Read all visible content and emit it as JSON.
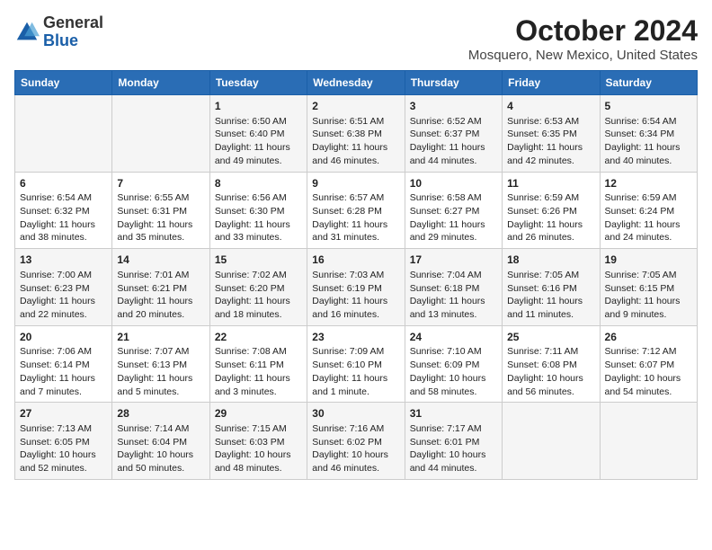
{
  "logo": {
    "general": "General",
    "blue": "Blue"
  },
  "title": "October 2024",
  "subtitle": "Mosquero, New Mexico, United States",
  "days_of_week": [
    "Sunday",
    "Monday",
    "Tuesday",
    "Wednesday",
    "Thursday",
    "Friday",
    "Saturday"
  ],
  "weeks": [
    [
      {
        "day": "",
        "info": ""
      },
      {
        "day": "",
        "info": ""
      },
      {
        "day": "1",
        "info": "Sunrise: 6:50 AM\nSunset: 6:40 PM\nDaylight: 11 hours and 49 minutes."
      },
      {
        "day": "2",
        "info": "Sunrise: 6:51 AM\nSunset: 6:38 PM\nDaylight: 11 hours and 46 minutes."
      },
      {
        "day": "3",
        "info": "Sunrise: 6:52 AM\nSunset: 6:37 PM\nDaylight: 11 hours and 44 minutes."
      },
      {
        "day": "4",
        "info": "Sunrise: 6:53 AM\nSunset: 6:35 PM\nDaylight: 11 hours and 42 minutes."
      },
      {
        "day": "5",
        "info": "Sunrise: 6:54 AM\nSunset: 6:34 PM\nDaylight: 11 hours and 40 minutes."
      }
    ],
    [
      {
        "day": "6",
        "info": "Sunrise: 6:54 AM\nSunset: 6:32 PM\nDaylight: 11 hours and 38 minutes."
      },
      {
        "day": "7",
        "info": "Sunrise: 6:55 AM\nSunset: 6:31 PM\nDaylight: 11 hours and 35 minutes."
      },
      {
        "day": "8",
        "info": "Sunrise: 6:56 AM\nSunset: 6:30 PM\nDaylight: 11 hours and 33 minutes."
      },
      {
        "day": "9",
        "info": "Sunrise: 6:57 AM\nSunset: 6:28 PM\nDaylight: 11 hours and 31 minutes."
      },
      {
        "day": "10",
        "info": "Sunrise: 6:58 AM\nSunset: 6:27 PM\nDaylight: 11 hours and 29 minutes."
      },
      {
        "day": "11",
        "info": "Sunrise: 6:59 AM\nSunset: 6:26 PM\nDaylight: 11 hours and 26 minutes."
      },
      {
        "day": "12",
        "info": "Sunrise: 6:59 AM\nSunset: 6:24 PM\nDaylight: 11 hours and 24 minutes."
      }
    ],
    [
      {
        "day": "13",
        "info": "Sunrise: 7:00 AM\nSunset: 6:23 PM\nDaylight: 11 hours and 22 minutes."
      },
      {
        "day": "14",
        "info": "Sunrise: 7:01 AM\nSunset: 6:21 PM\nDaylight: 11 hours and 20 minutes."
      },
      {
        "day": "15",
        "info": "Sunrise: 7:02 AM\nSunset: 6:20 PM\nDaylight: 11 hours and 18 minutes."
      },
      {
        "day": "16",
        "info": "Sunrise: 7:03 AM\nSunset: 6:19 PM\nDaylight: 11 hours and 16 minutes."
      },
      {
        "day": "17",
        "info": "Sunrise: 7:04 AM\nSunset: 6:18 PM\nDaylight: 11 hours and 13 minutes."
      },
      {
        "day": "18",
        "info": "Sunrise: 7:05 AM\nSunset: 6:16 PM\nDaylight: 11 hours and 11 minutes."
      },
      {
        "day": "19",
        "info": "Sunrise: 7:05 AM\nSunset: 6:15 PM\nDaylight: 11 hours and 9 minutes."
      }
    ],
    [
      {
        "day": "20",
        "info": "Sunrise: 7:06 AM\nSunset: 6:14 PM\nDaylight: 11 hours and 7 minutes."
      },
      {
        "day": "21",
        "info": "Sunrise: 7:07 AM\nSunset: 6:13 PM\nDaylight: 11 hours and 5 minutes."
      },
      {
        "day": "22",
        "info": "Sunrise: 7:08 AM\nSunset: 6:11 PM\nDaylight: 11 hours and 3 minutes."
      },
      {
        "day": "23",
        "info": "Sunrise: 7:09 AM\nSunset: 6:10 PM\nDaylight: 11 hours and 1 minute."
      },
      {
        "day": "24",
        "info": "Sunrise: 7:10 AM\nSunset: 6:09 PM\nDaylight: 10 hours and 58 minutes."
      },
      {
        "day": "25",
        "info": "Sunrise: 7:11 AM\nSunset: 6:08 PM\nDaylight: 10 hours and 56 minutes."
      },
      {
        "day": "26",
        "info": "Sunrise: 7:12 AM\nSunset: 6:07 PM\nDaylight: 10 hours and 54 minutes."
      }
    ],
    [
      {
        "day": "27",
        "info": "Sunrise: 7:13 AM\nSunset: 6:05 PM\nDaylight: 10 hours and 52 minutes."
      },
      {
        "day": "28",
        "info": "Sunrise: 7:14 AM\nSunset: 6:04 PM\nDaylight: 10 hours and 50 minutes."
      },
      {
        "day": "29",
        "info": "Sunrise: 7:15 AM\nSunset: 6:03 PM\nDaylight: 10 hours and 48 minutes."
      },
      {
        "day": "30",
        "info": "Sunrise: 7:16 AM\nSunset: 6:02 PM\nDaylight: 10 hours and 46 minutes."
      },
      {
        "day": "31",
        "info": "Sunrise: 7:17 AM\nSunset: 6:01 PM\nDaylight: 10 hours and 44 minutes."
      },
      {
        "day": "",
        "info": ""
      },
      {
        "day": "",
        "info": ""
      }
    ]
  ]
}
